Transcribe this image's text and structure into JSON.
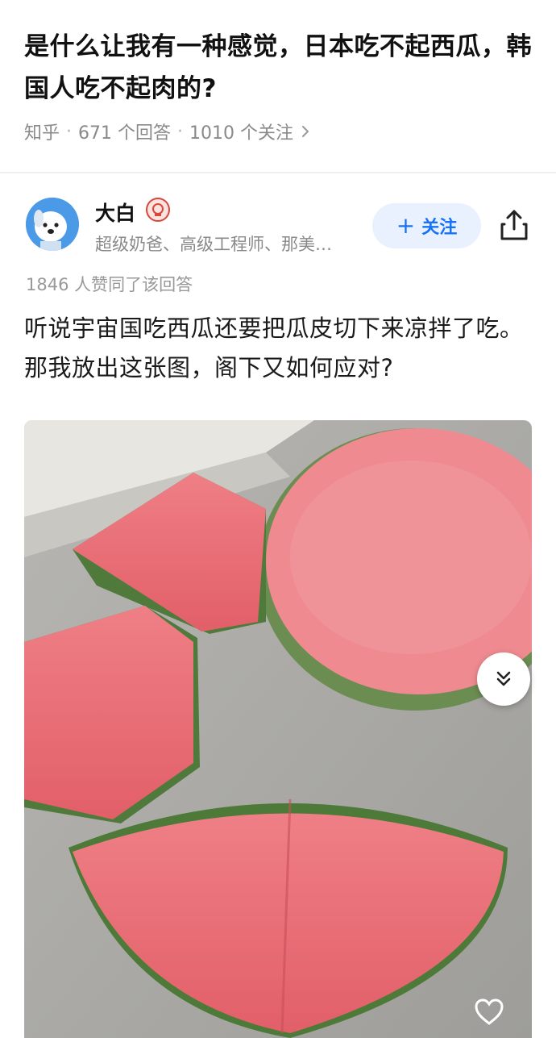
{
  "question": {
    "title": "是什么让我有一种感觉，日本吃不起西瓜，韩国人吃不起肉的?",
    "source": "知乎",
    "answers_count": "671 个回答",
    "followers_count": "1010 个关注",
    "chevron_icon": "chevron-right-icon"
  },
  "author": {
    "name": "大白",
    "bio": "超级奶爸、高级工程师、那美…",
    "follow_label": "关注",
    "follow_plus": "+",
    "avatar_icon": "dog-avatar",
    "badge_icon": "medal-badge-icon"
  },
  "answer": {
    "votes": "1846 人赞同了该回答",
    "text": "听说宇宙国吃西瓜还要把瓜皮切下来凉拌了吃。那我放出这张图，阁下又如何应对?"
  },
  "icons": {
    "share": "share-icon",
    "expand": "double-chevron-down-icon",
    "like": "heart-icon"
  },
  "colors": {
    "accent": "#1772f6",
    "follow_bg": "#eaf1fe",
    "meta_text": "#8a8a8a",
    "watermelon_flesh": "#e8737a",
    "rind": "#5f8a4a"
  }
}
